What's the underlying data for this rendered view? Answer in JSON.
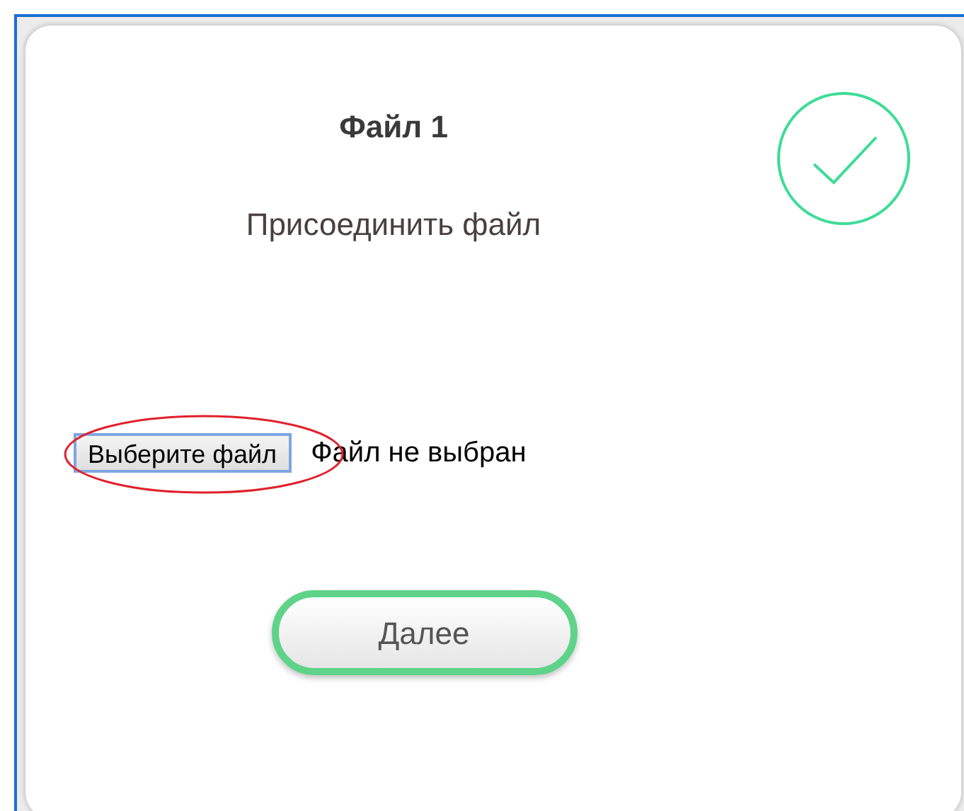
{
  "card": {
    "title": "Файл 1",
    "subtitle": "Присоединить файл",
    "completed": true
  },
  "file_picker": {
    "button_label": "Выберите файл",
    "status": "Файл не выбран",
    "highlighted": true
  },
  "next_button": {
    "label": "Далее"
  }
}
